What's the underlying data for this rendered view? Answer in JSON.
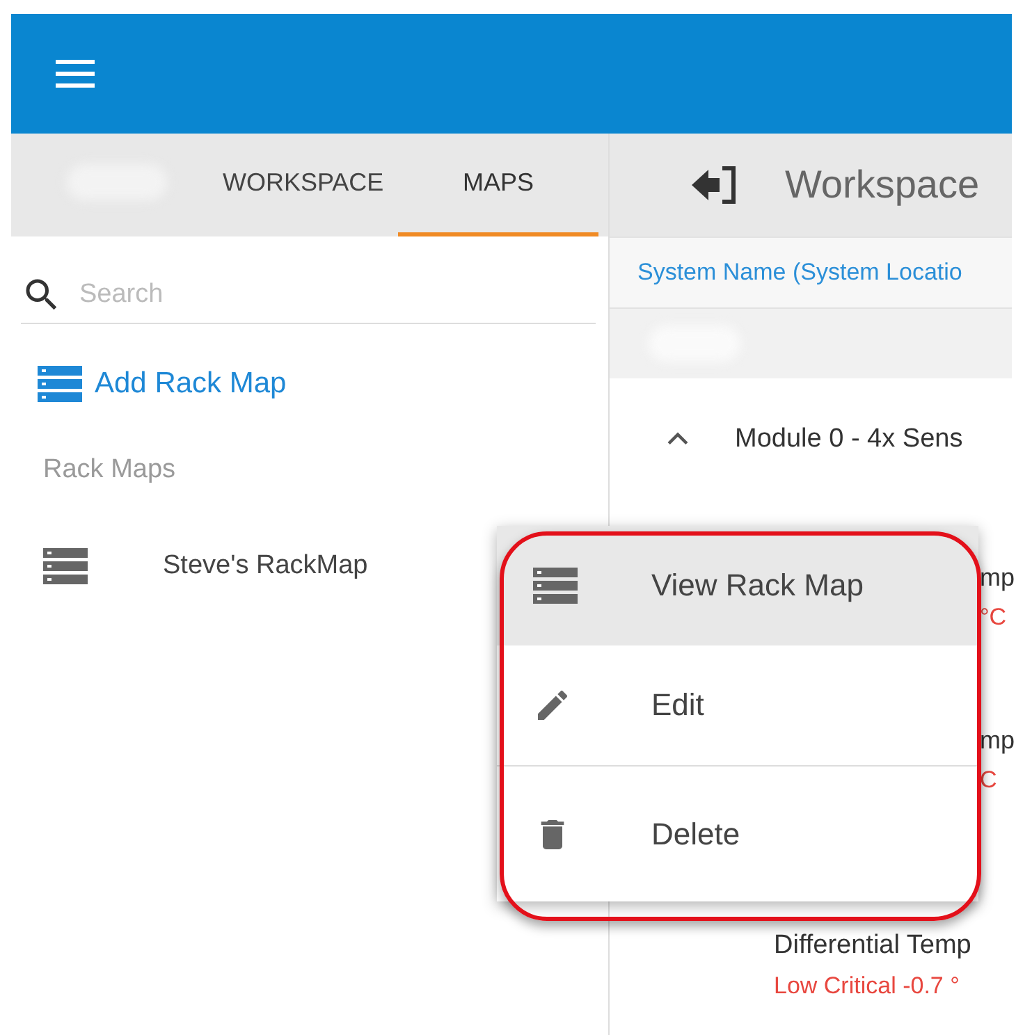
{
  "app_bar": {
    "menu_icon": true
  },
  "sidebar": {
    "tabs": [
      {
        "label": "WORKSPACE",
        "selected": false
      },
      {
        "label": "MAPS",
        "selected": true
      }
    ],
    "search": {
      "placeholder": "Search"
    },
    "add_button": "Add Rack Map",
    "section_title": "Rack Maps",
    "items": [
      {
        "label": "Steve's RackMap"
      }
    ]
  },
  "main": {
    "title": "Workspace",
    "column_header": "System Name (System Locatio",
    "module": {
      "label": "Module 0 - 4x Sens",
      "expanded": true
    },
    "sensors": [
      {
        "kind": "peek",
        "name": "mp",
        "reading": "°C"
      },
      {
        "kind": "peek",
        "name": "mp",
        "reading": "C"
      },
      {
        "kind": "full",
        "name": "Differential Temp",
        "reading": "Low Critical -0.7 °"
      }
    ]
  },
  "context_menu": {
    "items": [
      {
        "label": "View Rack Map",
        "selected": true
      },
      {
        "label": "Edit",
        "selected": false
      },
      {
        "label": "Delete",
        "selected": false
      }
    ]
  }
}
